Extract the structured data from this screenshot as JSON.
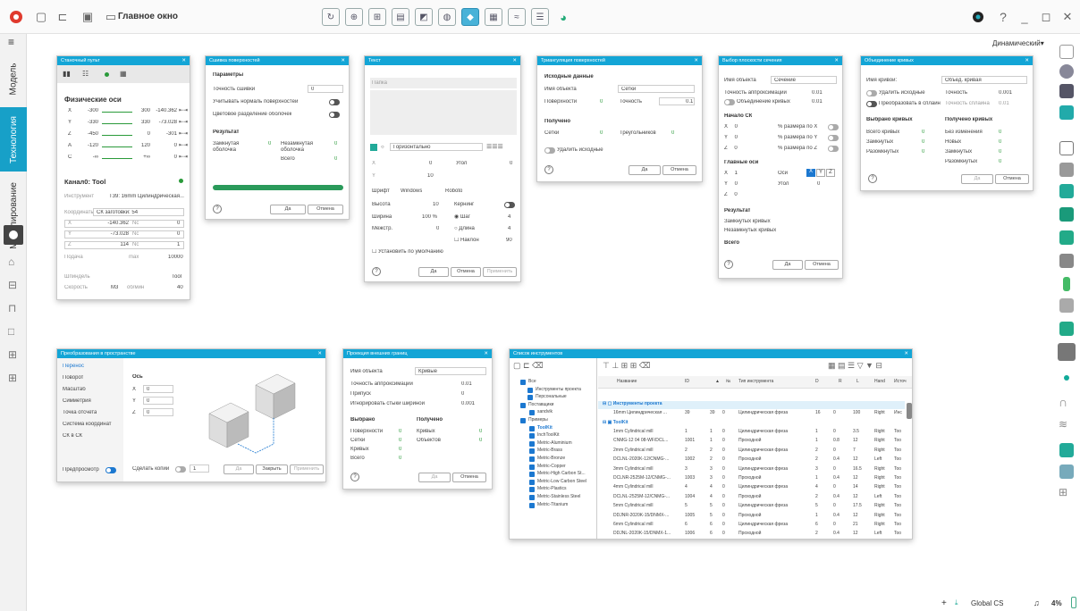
{
  "app": {
    "window_title": "Главное окно"
  },
  "toolbar": {
    "qmark": "?",
    "minimize": "_",
    "restore": "◻",
    "close": "✕"
  },
  "left_tabs": [
    "Модель",
    "Технология",
    "Моделирование"
  ],
  "right": {
    "mode": "Динамический▾"
  },
  "status": {
    "cs": "Global CS",
    "percent": "4%",
    "plus": "+"
  },
  "machine": {
    "title": "Станочный пульт",
    "axes_title": "Физические оси",
    "axes": [
      {
        "n": "X",
        "min": "-300",
        "max": "300",
        "v": "-140.362"
      },
      {
        "n": "Y",
        "min": "-330",
        "max": "330",
        "v": "-73.028"
      },
      {
        "n": "Z",
        "min": "-450",
        "max": "0",
        "v": "-301"
      },
      {
        "n": "A",
        "min": "-120",
        "max": "120",
        "v": "0"
      },
      {
        "n": "C",
        "min": "-∞",
        "max": "+∞",
        "v": "0"
      }
    ],
    "channel": "Канал0: Tool",
    "tool_l": "Инструмент",
    "tool_v": "T39: 16mm Цилиндрическая...",
    "coord_l": "Координаты",
    "coord_v": "СК заготовки: 54",
    "rows": [
      {
        "a": "X",
        "v": "-140.362",
        "b": "Nc",
        "w": "0"
      },
      {
        "a": "Y",
        "v": "-73.028",
        "b": "Nc",
        "w": "0"
      },
      {
        "a": "Z",
        "v": "114",
        "b": "Nc",
        "w": "1"
      }
    ],
    "feed_l": "Подача",
    "feed_u": "max",
    "feed_v": "10000",
    "spindle_l": "Шпиндель",
    "spindle_v": "Tool",
    "speed_l": "Скорость",
    "speed_m": "M3",
    "speed_u": "об/мин",
    "speed_v": "40"
  },
  "stitch": {
    "title": "Сшивка поверхностей",
    "params": "Параметры",
    "acc_l": "Точность сшивки",
    "acc_v": "0",
    "norm_l": "Учитывать нормаль поверхностей",
    "color_l": "Цветовое разделение оболочек",
    "res": "Результат",
    "closed_l": "Замкнутая оболочка",
    "closed_v": "0",
    "open_l": "Незамкнутая оболочка",
    "open_v": "0",
    "total_l": "Всего",
    "total_v": "0",
    "ok": "Да",
    "cancel": "Отмена"
  },
  "text": {
    "title": "Текст",
    "field": "Папка",
    "orient": "Горизонтально",
    "x": "X",
    "xv": "0",
    "y": "Y",
    "yv": "10",
    "angle_l": "Угол",
    "angle_v": "0",
    "font_l": "Шрифт",
    "font_v": "Windows",
    "font2": "Roboto",
    "h_l": "Высота",
    "h_v": "10",
    "kern": "Кернинг",
    "w_l": "Ширина",
    "w_v": "100 %",
    "step_l": "Шаг",
    "step_v": "4",
    "ml_l": "Межстр.",
    "ml_v": "0",
    "len_l": "Длина",
    "len_v": "4",
    "tilt_l": "Наклон",
    "tilt_v": "90",
    "def": "Установить по умолчанию",
    "ok": "Да",
    "cancel": "Отмена",
    "apply": "Применить"
  },
  "tri": {
    "title": "Триангуляция поверхностей",
    "src": "Исходные данные",
    "name_l": "Имя объекта",
    "name_v": "Сетки",
    "surf_l": "Поверхности",
    "surf_v": "0",
    "acc_l": "Точность",
    "acc_v": "0.1",
    "got": "Получено",
    "mesh_l": "Сетки",
    "mesh_v": "0",
    "tri_l": "Треугольников",
    "tri_v": "0",
    "del": "Удалить исходные",
    "ok": "Да",
    "cancel": "Отмена"
  },
  "plane": {
    "title": "Выбор плоскости сечения",
    "name_l": "Имя объекта",
    "name_v": "Сечение",
    "acc_l": "Точность аппроксимации",
    "acc_v": "0.01",
    "merge": "Объединение кривых",
    "merge_v": "0.01",
    "origin": "Начало СК",
    "ox": "0",
    "oy": "0",
    "oz": "0",
    "px": "% размера по X",
    "py": "% размера по Y",
    "pz": "% размера по Z",
    "axes": "Главные оси",
    "ax": "1",
    "ay": "0",
    "az": "0",
    "axes_l": "Оси",
    "angle_l": "Угол",
    "angle_v": "0",
    "res": "Результат",
    "closed": "Замкнутых кривых",
    "open": "Незамкнутых кривых",
    "total": "Всего",
    "ok": "Да",
    "cancel": "Отмена"
  },
  "union": {
    "title": "Объединение кривых",
    "name_l": "Имя кривой:",
    "name_v": "Объед. кривая",
    "del": "Удалить исходные",
    "acc_l": "Точность",
    "acc_v": "0.001",
    "spline": "Преобразовать в сплайн",
    "sacc_l": "Точность сплайна",
    "sacc_v": "0.01",
    "sel": "Выбрано кривых",
    "got": "Получено кривых",
    "all_l": "Всего кривых",
    "all_v": "0",
    "nochg": "Без изменения",
    "nochg_v": "0",
    "cl": "Замкнутых",
    "cl_v": "0",
    "new": "Новых",
    "new_v": "0",
    "op": "Разомкнутых",
    "op_v": "0",
    "cl2": "Замкнутых",
    "cl2_v": "0",
    "op2": "Разомкнутых",
    "op2_v": "0",
    "ok": "Да",
    "cancel": "Отмена"
  },
  "transform": {
    "title": "Преобразования в пространстве",
    "items": [
      "Перенос",
      "Поворот",
      "Масштаб",
      "Симметрия",
      "Точка отсчета",
      "Система координат",
      "СК в СК"
    ],
    "axis": "Ось",
    "x": "0",
    "y": "0",
    "z": "0",
    "preview": "Предпросмотр",
    "copies": "Сделать копии",
    "copies_v": "1",
    "ok": "Да",
    "close": "Закрыть",
    "apply": "Применить"
  },
  "proj": {
    "title": "Проекция внешних границ",
    "name_l": "Имя объекта",
    "name_v": "Кривые",
    "acc_l": "Точность аппроксимации",
    "acc_v": "0.01",
    "al_l": "Припуск",
    "al_v": "0",
    "ign_l": "Игнорировать стыки шириной",
    "ign_v": "0.001",
    "sel": "Выбрано",
    "got": "Получено",
    "surf_l": "Поверхности",
    "surf_v": "0",
    "curv_l": "Кривых",
    "curv_v": "0",
    "mesh_l": "Сетки",
    "mesh_v": "0",
    "obj_l": "Объектов",
    "obj_v": "0",
    "cv_l": "Кривых",
    "cv_v": "0",
    "all_l": "Всего",
    "all_v": "0",
    "ok": "Да",
    "cancel": "Отмена"
  },
  "tools": {
    "title": "Список инструментов",
    "tree": [
      "Все",
      "Инструменты проекта",
      "Персональные",
      "Поставщики",
      "sandvik",
      "Примеры",
      "ToolKit",
      "InchToolKit",
      "Metric-Aluminium",
      "Metric-Brass",
      "Metric-Bronze",
      "Metric-Copper",
      "Metric-High Carbon St...",
      "Metric-Low Carbon Steel",
      "Metric-Plastics",
      "Metric-Stainless Steel",
      "Metric-Titanium"
    ],
    "cols": [
      "Название",
      "ID",
      "▲",
      "№",
      "Тип инструмента",
      "D",
      "R",
      "L",
      "Hand",
      "Источ"
    ],
    "group1": "Инструменты проекта",
    "group2": "ToolKit",
    "rows": [
      [
        "16mm Цилиндрическая ...",
        "39",
        "39",
        "0",
        "Цилиндрическая фреза",
        "16",
        "0",
        "100",
        "Right",
        "Инс"
      ],
      [
        "1mm Cylindrical mill",
        "1",
        "1",
        "0",
        "Цилиндрическая фреза",
        "1",
        "0",
        "3.5",
        "Right",
        "Too"
      ],
      [
        "CNMG-12 04 08-WF/DCL...",
        "1001",
        "1",
        "0",
        "Проходной",
        "1",
        "0.8",
        "12",
        "Right",
        "Too"
      ],
      [
        "2mm Cylindrical mill",
        "2",
        "2",
        "0",
        "Цилиндрическая фреза",
        "2",
        "0",
        "7",
        "Right",
        "Too"
      ],
      [
        "DCLNL-2020K-12/CNMG-...",
        "1002",
        "2",
        "0",
        "Проходной",
        "2",
        "0.4",
        "12",
        "Left",
        "Too"
      ],
      [
        "3mm Cylindrical mill",
        "3",
        "3",
        "0",
        "Цилиндрическая фреза",
        "3",
        "0",
        "16.5",
        "Right",
        "Too"
      ],
      [
        "DCLNR-2525M-12/CNMG-...",
        "1003",
        "3",
        "0",
        "Проходной",
        "1",
        "0.4",
        "12",
        "Right",
        "Too"
      ],
      [
        "4mm Cylindrical mill",
        "4",
        "4",
        "0",
        "Цилиндрическая фреза",
        "4",
        "0",
        "14",
        "Right",
        "Too"
      ],
      [
        "DCLNL-2525M-12/CNMG-...",
        "1004",
        "4",
        "0",
        "Проходной",
        "2",
        "0.4",
        "12",
        "Left",
        "Too"
      ],
      [
        "5mm Cylindrical mill",
        "5",
        "5",
        "0",
        "Цилиндрическая фреза",
        "5",
        "0",
        "17.5",
        "Right",
        "Too"
      ],
      [
        "DDJNR-2020K-15/DNMX-...",
        "1005",
        "5",
        "0",
        "Проходной",
        "1",
        "0.4",
        "12",
        "Right",
        "Too"
      ],
      [
        "6mm Cylindrical mill",
        "6",
        "6",
        "0",
        "Цилиндрическая фреза",
        "6",
        "0",
        "21",
        "Right",
        "Too"
      ],
      [
        "DDJNL-2020K-15/DNMX-1...",
        "1006",
        "6",
        "0",
        "Проходной",
        "2",
        "0.4",
        "12",
        "Left",
        "Too"
      ]
    ]
  }
}
